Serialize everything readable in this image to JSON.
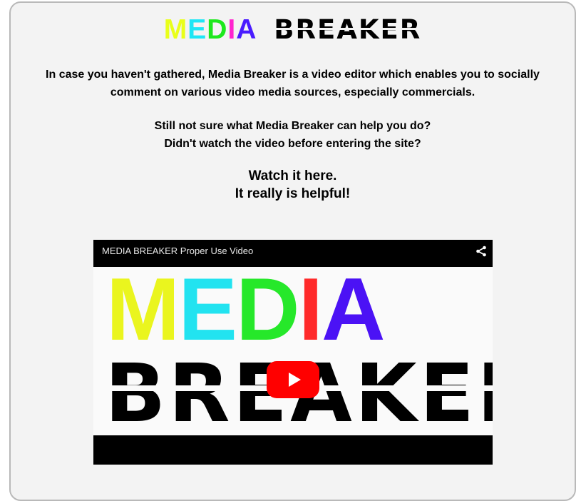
{
  "logo": {
    "media_letters": [
      {
        "char": "M",
        "color": "#e9ff1a"
      },
      {
        "char": "E",
        "color": "#1ce6f5"
      },
      {
        "char": "D",
        "color": "#1de81d"
      },
      {
        "char": "I",
        "color": "#ff24cf"
      },
      {
        "char": "A",
        "color": "#4a1cff"
      }
    ],
    "breaker": "BREAKER"
  },
  "intro": {
    "line1": "In case you haven't gathered, Media Breaker is a video editor which enables you to socially",
    "line2": "comment on various video media sources, especially commercials."
  },
  "question": {
    "line1": "Still not sure what Media Breaker can help you do?",
    "line2": "Didn't watch the video before entering the site?"
  },
  "cta": {
    "line1": "Watch it here.",
    "line2": "It really is helpful!"
  },
  "video": {
    "title": "MEDIA BREAKER Proper Use Video",
    "thumb_media": [
      {
        "char": "M",
        "color": "#eaf51e"
      },
      {
        "char": "E",
        "color": "#22e3f0"
      },
      {
        "char": "D",
        "color": "#26e82a"
      },
      {
        "char": "I",
        "color": "#ff2a2a"
      },
      {
        "char": "A",
        "color": "#4b12f5"
      }
    ],
    "thumb_breaker": "BREAKER",
    "play_icon": "youtube-play-icon",
    "share_icon": "share-icon"
  }
}
